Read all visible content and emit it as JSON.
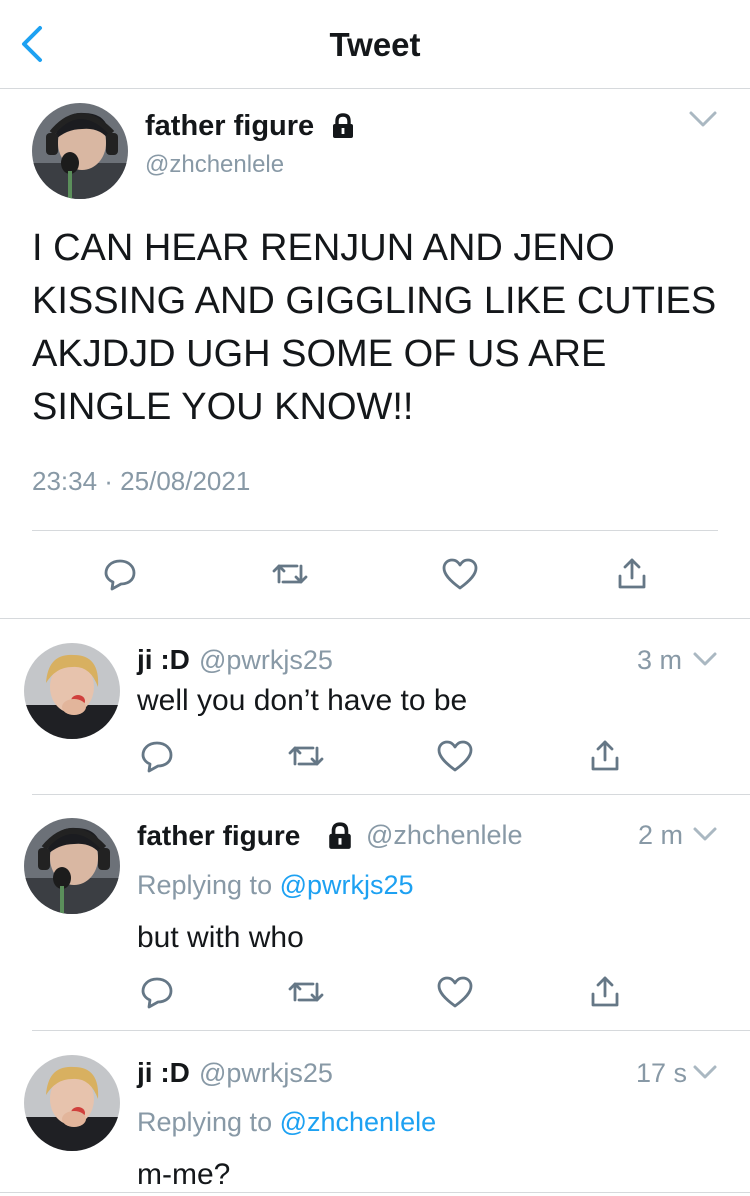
{
  "header": {
    "title": "Tweet"
  },
  "main_tweet": {
    "display_name": "father figure",
    "handle": "@zhchenlele",
    "text": "I CAN HEAR RENJUN AND JENO KISSING AND GIGGLING LIKE CUTIES AKJDJD UGH SOME OF US ARE SINGLE YOU KNOW!!",
    "timestamp": "23:34 · 25/08/2021"
  },
  "replies": [
    {
      "display_name": "ji :D",
      "handle": "@pwrkjs25",
      "time": "3 m",
      "text": "well you don’t have to be"
    },
    {
      "display_name": "father figure",
      "handle": "@zhchenlele",
      "time": "2 m",
      "replying_prefix": "Replying to ",
      "replying_to": "@pwrkjs25",
      "text": "but with who"
    },
    {
      "display_name": "ji :D",
      "handle": "@pwrkjs25",
      "time": "17 s",
      "replying_prefix": "Replying to ",
      "replying_to": "@zhchenlele",
      "text": "m-me?"
    }
  ],
  "colors": {
    "accent": "#1da1f2",
    "icon_grey": "#657786",
    "divider": "#d6d9dc"
  }
}
